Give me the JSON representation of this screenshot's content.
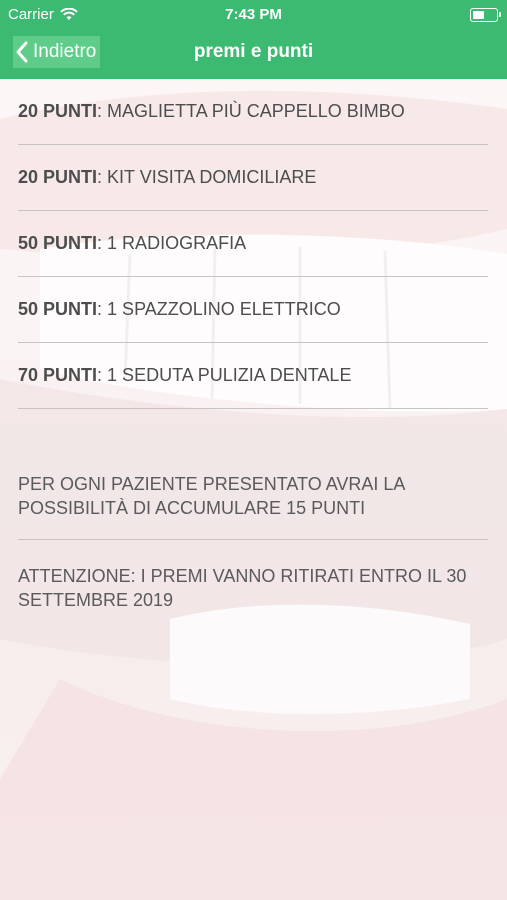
{
  "status_bar": {
    "carrier": "Carrier",
    "time": "7:43 PM"
  },
  "nav": {
    "back_label": "Indietro",
    "title": "premi e punti"
  },
  "rewards": [
    {
      "points": "20 PUNTI",
      "item": "MAGLIETTA PIÙ CAPPELLO BIMBO"
    },
    {
      "points": "20 PUNTI",
      "item": "KIT VISITA DOMICILIARE"
    },
    {
      "points": "50 PUNTI",
      "item": "1 RADIOGRAFIA"
    },
    {
      "points": "50 PUNTI",
      "item": "1 SPAZZOLINO ELETTRICO"
    },
    {
      "points": "70 PUNTI",
      "item": "1 SEDUTA PULIZIA DENTALE"
    }
  ],
  "info": {
    "referral": "PER OGNI PAZIENTE PRESENTATO AVRAI LA POSSIBILITÀ DI ACCUMULARE 15 PUNTI",
    "notice": "ATTENZIONE: I PREMI VANNO RITIRATI ENTRO IL 30 SETTEMBRE 2019"
  },
  "colors": {
    "accent": "#3dba71",
    "text": "#4d4d4d"
  },
  "icons": {
    "back": "chevron-left-icon",
    "wifi": "wifi-icon",
    "battery": "battery-icon"
  }
}
